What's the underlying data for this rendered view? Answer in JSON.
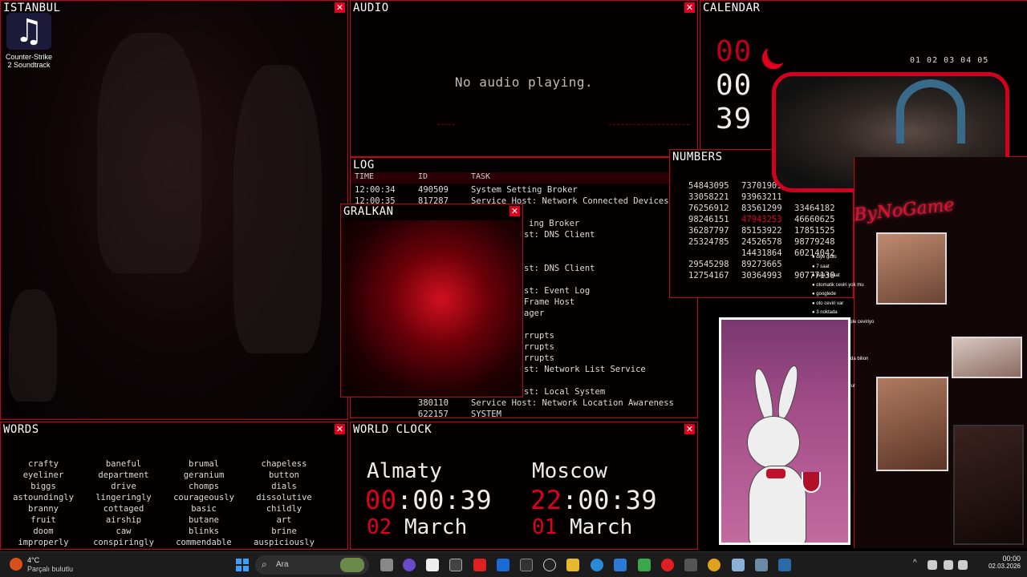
{
  "panels": {
    "istanbul": "ISTANBUL",
    "audio": "AUDIO",
    "calendar": "CALENDAR",
    "log": "LOG",
    "gralkan": "GRALKAN",
    "numbers": "NUMBERS",
    "words": "WORDS",
    "world_clock": "WORLD CLOCK",
    "close_glyph": "✕"
  },
  "desktop_icon": {
    "glyph": "♫",
    "label": "Counter-Strike 2 Soundtrack"
  },
  "audio": {
    "message": "No audio playing."
  },
  "calendar": {
    "hours": "00",
    "minutes": "00",
    "seconds": "39",
    "days_row": "01 02 03 04 05"
  },
  "log": {
    "headers": [
      "TIME",
      "ID",
      "TASK"
    ],
    "rows": [
      {
        "time": "12:00:34",
        "id": "490509",
        "task": "System Setting Broker"
      },
      {
        "time": "12:00:35",
        "id": "817287",
        "task": "Service Host: Network Connected Devices"
      },
      {
        "time": "",
        "id": "",
        "task": "ing Broker"
      },
      {
        "time": "",
        "id": "",
        "task": "st: DNS Client"
      },
      {
        "time": "",
        "id": "",
        "task": "st: DNS Client"
      },
      {
        "time": "",
        "id": "",
        "task": "st: Event Log"
      },
      {
        "time": "",
        "id": "",
        "task": "Frame Host"
      },
      {
        "time": "",
        "id": "",
        "task": "ager"
      },
      {
        "time": "",
        "id": "",
        "task": "rrupts"
      },
      {
        "time": "",
        "id": "",
        "task": "rrupts"
      },
      {
        "time": "",
        "id": "",
        "task": "rrupts"
      },
      {
        "time": "",
        "id": "",
        "task": "st: Network List Service"
      },
      {
        "time": "",
        "id": "",
        "task": "st: Local System"
      },
      {
        "time": "",
        "id": "380110",
        "task": "Service Host: Network Location Awareness"
      },
      {
        "time": "",
        "id": "622157",
        "task": "SYSTEM"
      }
    ]
  },
  "numbers": {
    "col1": [
      "54843095",
      "33058221",
      "76256912",
      "98246151",
      "36287797",
      "25324785",
      "",
      "29545298",
      "12754167"
    ],
    "col2": [
      "73701901",
      "93963211",
      "83561299",
      "47943253",
      "85153922",
      "24526578",
      "14431864",
      "89273665",
      "30364993"
    ],
    "col3": [
      "",
      "",
      "33464182",
      "46660625",
      "17851525",
      "98779248",
      "60214042",
      "",
      "90777130"
    ],
    "red_cells": [
      "47943253"
    ]
  },
  "overlay": {
    "channel_tag": "ByNoGame",
    "chat": [
      "diye gidio",
      "7 saat",
      "hala 9 saat",
      "otomatik ceviri yok mu",
      "googlede",
      "oto ceviri var",
      "3 noktada",
      "sayfaya gir komple ceviriyo",
      "sag yazio",
      "dedigime bak",
      "9 saat dedigime",
      "aaa gruba katilada bilion",
      "8k'ya katilsana",
      "en buyuk hatam",
      "bebe nAMin buyur"
    ]
  },
  "words": [
    [
      "crafty",
      "eyeliner",
      "biggs",
      "astoundingly",
      "branny",
      "fruit",
      "doom",
      "improperly"
    ],
    [
      "baneful",
      "department",
      "drive",
      "lingeringly",
      "cottaged",
      "airship",
      "caw",
      "conspiringly"
    ],
    [
      "brumal",
      "geranium",
      "chomps",
      "courageously",
      "basic",
      "butane",
      "blinks",
      "commendable"
    ],
    [
      "chapeless",
      "button",
      "dials",
      "dissolutive",
      "childly",
      "art",
      "brine",
      "auspiciously"
    ]
  ],
  "world_clock": [
    {
      "city": "Almaty",
      "hour": "00",
      "rest": ":00:39",
      "day": "02",
      "month": "March"
    },
    {
      "city": "Moscow",
      "hour": "22",
      "rest": ":00:39",
      "day": "01",
      "month": "March"
    }
  ],
  "taskbar": {
    "weather_temp": "4°C",
    "weather_desc": "Parçalı bulutlu",
    "search_placeholder": "Ara",
    "clock_time": "00:00",
    "clock_date": "02.03.2026",
    "tray_chevron": "^",
    "colors": {
      "accent_red": "#e0001e",
      "panel_border": "#c8001e"
    }
  }
}
